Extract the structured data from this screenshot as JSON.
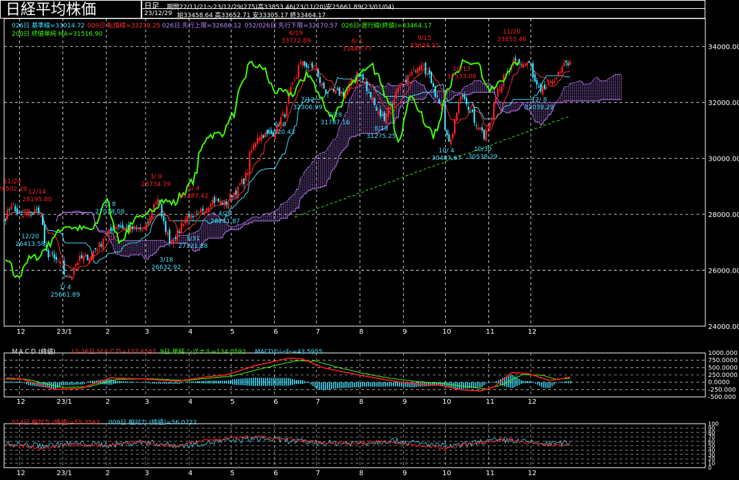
{
  "header": {
    "title": "日経平均株価",
    "period_type": "日足",
    "period_info": "期間22/11/21〜23/12/29(275)高33853.46(23/11/20)安25661.89(23/01/04)",
    "date": "23/12/29",
    "ohlc": "始33458.64 高33652.71 安33305.17 終33464.17"
  },
  "indicators": {
    "kijun": "026日 基準線=33014.72",
    "tenkan": "009日 転換線=33239.25",
    "senko_a": "026日 先行上限=32686.12",
    "senko_b": "052/026日 先行下限=32170.57",
    "chikou": "026日 遅行線(終値)=33464.17",
    "ma200": "200日 終値単純 MA=31516.90"
  },
  "macd_legend": {
    "title": "ＭＡＣＤ (終値)",
    "macd": "12-26日 ＭＡＣＤ=177.6547",
    "signal": "9日 単純 シグナル=134.0592",
    "osc": "MACDｵｼﾚｰﾀｰ=43.5955"
  },
  "rsi_legend": {
    "rsi14": "014日 相対力 (終値)=55.3562",
    "rsi9": "009日 相対力 (終値)=56.0722"
  },
  "colors": {
    "bg": "#000000",
    "up": "#ff2020",
    "down": "#40e0ff",
    "tenkan": "#ff3030",
    "kijun": "#40e0ff",
    "chikou": "#40ff00",
    "cloud": "#c080ff",
    "grid": "#ffffff",
    "ma": "#40ff00"
  },
  "chart_data": [
    {
      "type": "candlestick",
      "title": "日経平均株価",
      "ylim": [
        24000,
        35000
      ],
      "y_ticks": [
        "34000.00",
        "32000.00",
        "30000.00",
        "28000.00",
        "26000.00",
        "24000.00"
      ],
      "x_ticks": [
        "12",
        "23/1",
        "2",
        "3",
        "4",
        "5",
        "6",
        "7",
        "8",
        "9",
        "10",
        "11",
        "12"
      ],
      "close_path": [
        [
          "22/11/21",
          27900
        ],
        [
          "22/11/24",
          28383
        ],
        [
          "22/12/01",
          27900
        ],
        [
          "22/12/14",
          28156
        ],
        [
          "22/12/20",
          26600
        ],
        [
          "22/12/28",
          26300
        ],
        [
          "23/01/04",
          25716
        ],
        [
          "23/01/12",
          26400
        ],
        [
          "23/01/20",
          26500
        ],
        [
          "23/02/01",
          27300
        ],
        [
          "23/02/08",
          27600
        ],
        [
          "23/02/15",
          27500
        ],
        [
          "23/02/28",
          27450
        ],
        [
          "23/03/09",
          28600
        ],
        [
          "23/03/18",
          26900
        ],
        [
          "23/03/31",
          28000
        ],
        [
          "23/04/04",
          27800
        ],
        [
          "23/04/17",
          28500
        ],
        [
          "23/04/27",
          28400
        ],
        [
          "23/05/10",
          29200
        ],
        [
          "23/05/19",
          30800
        ],
        [
          "23/05/31",
          30900
        ],
        [
          "23/06/08",
          31600
        ],
        [
          "23/06/19",
          33400
        ],
        [
          "23/06/30",
          33200
        ],
        [
          "23/07/07",
          32400
        ],
        [
          "23/07/21",
          32300
        ],
        [
          "23/07/31",
          33100
        ],
        [
          "23/08/08",
          32300
        ],
        [
          "23/08/18",
          31400
        ],
        [
          "23/08/31",
          32600
        ],
        [
          "23/09/15",
          33500
        ],
        [
          "23/09/29",
          31800
        ],
        [
          "23/10/04",
          30526
        ],
        [
          "23/10/13",
          32300
        ],
        [
          "23/10/30",
          30700
        ],
        [
          "23/11/08",
          32500
        ],
        [
          "23/11/20",
          33400
        ],
        [
          "23/11/30",
          33400
        ],
        [
          "23/12/08",
          32300
        ],
        [
          "23/12/18",
          32800
        ],
        [
          "23/12/26",
          33300
        ],
        [
          "23/12/29",
          33464
        ]
      ],
      "peaks": [
        {
          "date": "11/24",
          "value": "28502.29"
        },
        {
          "date": "12/14",
          "value": "28195.80"
        },
        {
          "date": "3/ 9",
          "value": "28734.79"
        },
        {
          "date": "5/ 4",
          "value": "29287.42"
        },
        {
          "date": "6/19",
          "value": "33772.89"
        },
        {
          "date": "8/ 1",
          "value": "33488.77"
        },
        {
          "date": "9/15",
          "value": "33634.31"
        },
        {
          "date": "10/13",
          "value": "32533.08"
        },
        {
          "date": "11/20",
          "value": "33853.46"
        }
      ],
      "troughs": [
        {
          "date": "12/20",
          "value": "26413.58"
        },
        {
          "date": "1/ 4",
          "value": "25661.89"
        },
        {
          "date": "2/ 8",
          "value": "27018.08"
        },
        {
          "date": "3/18",
          "value": "26632.92"
        },
        {
          "date": "3/31",
          "value": "27121.88"
        },
        {
          "date": "4/27",
          "value": "28241.87"
        },
        {
          "date": "6/ 8",
          "value": "31420.43"
        },
        {
          "date": "7/12",
          "value": "32306.99"
        },
        {
          "date": "7/28",
          "value": "31787.16"
        },
        {
          "date": "8/18",
          "value": "31275.25"
        },
        {
          "date": "10/ 4",
          "value": "30487.67"
        },
        {
          "date": "10/30",
          "value": "30538.29"
        },
        {
          "date": "12/ 8",
          "value": "32039.29"
        }
      ]
    },
    {
      "type": "line",
      "title": "ＭＡＣＤ (終値)",
      "ylim": [
        -500,
        1000
      ],
      "y_ticks": [
        "1000.000",
        "750.0000",
        "500.0000",
        "250.0000",
        "0.0000",
        "-250.000",
        "-500.000"
      ],
      "series": [
        {
          "name": "12-26日 ＭＡＣＤ",
          "points": [
            [
              0,
              150
            ],
            [
              30,
              120
            ],
            [
              80,
              -250
            ],
            [
              120,
              -200
            ],
            [
              160,
              150
            ],
            [
              210,
              110
            ],
            [
              260,
              40
            ],
            [
              300,
              180
            ],
            [
              330,
              250
            ],
            [
              370,
              560
            ],
            [
              420,
              820
            ],
            [
              440,
              800
            ],
            [
              470,
              500
            ],
            [
              520,
              260
            ],
            [
              560,
              90
            ],
            [
              600,
              -50
            ],
            [
              640,
              -100
            ],
            [
              670,
              -250
            ],
            [
              700,
              -300
            ],
            [
              720,
              -150
            ],
            [
              745,
              330
            ],
            [
              770,
              290
            ],
            [
              800,
              60
            ],
            [
              830,
              177
            ]
          ]
        },
        {
          "name": "9日 単純 シグナル",
          "points": [
            [
              0,
              120
            ],
            [
              40,
              100
            ],
            [
              90,
              -180
            ],
            [
              130,
              -150
            ],
            [
              170,
              100
            ],
            [
              220,
              120
            ],
            [
              270,
              60
            ],
            [
              310,
              150
            ],
            [
              340,
              220
            ],
            [
              380,
              460
            ],
            [
              430,
              730
            ],
            [
              460,
              720
            ],
            [
              490,
              520
            ],
            [
              530,
              300
            ],
            [
              570,
              130
            ],
            [
              610,
              20
            ],
            [
              650,
              -60
            ],
            [
              680,
              -150
            ],
            [
              710,
              -230
            ],
            [
              735,
              -50
            ],
            [
              760,
              260
            ],
            [
              790,
              240
            ],
            [
              810,
              100
            ],
            [
              830,
              134
            ]
          ]
        }
      ]
    },
    {
      "type": "line",
      "title": "相対力",
      "ylim": [
        0,
        100
      ],
      "series": [
        {
          "name": "014日 相対力 (終値)",
          "points": [
            [
              0,
              55
            ],
            [
              60,
              45
            ],
            [
              100,
              52
            ],
            [
              150,
              50
            ],
            [
              200,
              60
            ],
            [
              250,
              48
            ],
            [
              300,
              62
            ],
            [
              370,
              70
            ],
            [
              420,
              64
            ],
            [
              460,
              58
            ],
            [
              520,
              55
            ],
            [
              560,
              60
            ],
            [
              600,
              52
            ],
            [
              650,
              45
            ],
            [
              700,
              58
            ],
            [
              740,
              65
            ],
            [
              790,
              52
            ],
            [
              830,
              55
            ]
          ]
        },
        {
          "name": "009日 相対力 (終値)",
          "points": [
            [
              0,
              55
            ],
            [
              60,
              50
            ],
            [
              110,
              55
            ],
            [
              160,
              52
            ],
            [
              210,
              58
            ],
            [
              260,
              50
            ],
            [
              310,
              58
            ],
            [
              380,
              66
            ],
            [
              430,
              60
            ],
            [
              470,
              56
            ],
            [
              530,
              56
            ],
            [
              570,
              62
            ],
            [
              610,
              55
            ],
            [
              660,
              48
            ],
            [
              705,
              60
            ],
            [
              745,
              62
            ],
            [
              795,
              54
            ],
            [
              830,
              56
            ]
          ]
        }
      ]
    }
  ]
}
